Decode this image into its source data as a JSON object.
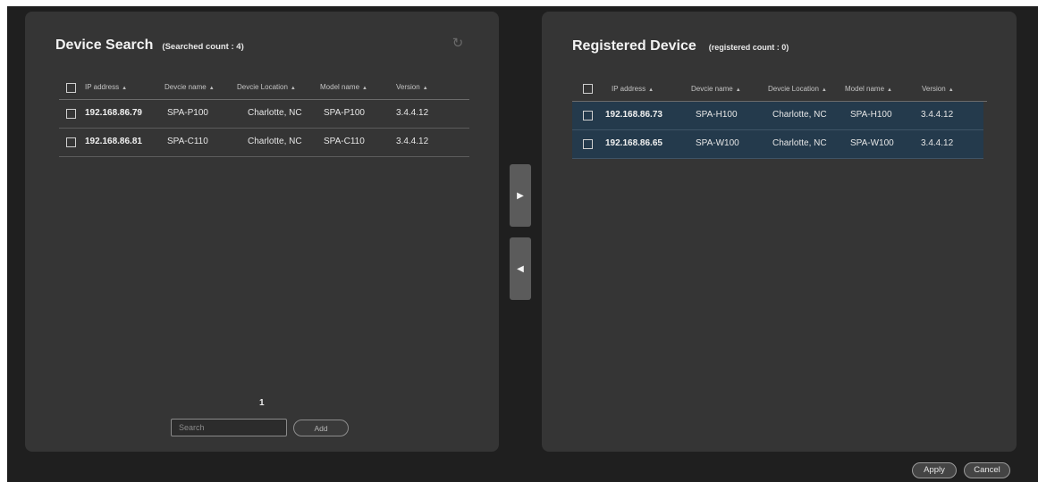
{
  "search_panel": {
    "title": "Device Search",
    "count_label": "(Searched count : 4)",
    "refresh_icon": "refresh-icon",
    "columns": [
      "IP address",
      "Devcie name",
      "Devcie Location",
      "Model name",
      "Version"
    ],
    "rows": [
      {
        "ip": "192.168.86.79",
        "device": "SPA-P100",
        "location": "Charlotte, NC",
        "model": "SPA-P100",
        "version": "3.4.4.12"
      },
      {
        "ip": "192.168.86.81",
        "device": "SPA-C110",
        "location": "Charlotte, NC",
        "model": "SPA-C110",
        "version": "3.4.4.12"
      }
    ],
    "page": "1",
    "search_placeholder": "Search",
    "search_value": "",
    "add_label": "Add"
  },
  "registered_panel": {
    "title": "Registered Device",
    "count_label": "(registered count : 0)",
    "columns": [
      "IP address",
      "Devcie name",
      "Devcie Location",
      "Model name",
      "Version"
    ],
    "rows": [
      {
        "ip": "192.168.86.73",
        "device": "SPA-H100",
        "location": "Charlotte, NC",
        "model": "SPA-H100",
        "version": "3.4.4.12"
      },
      {
        "ip": "192.168.86.65",
        "device": "SPA-W100",
        "location": "Charlotte, NC",
        "model": "SPA-W100",
        "version": "3.4.4.12"
      }
    ]
  },
  "transfer": {
    "right_icon": "play-right-icon",
    "left_icon": "play-left-icon"
  },
  "footer": {
    "apply_label": "Apply",
    "cancel_label": "Cancel"
  },
  "colors": {
    "background": "#1f1f1f",
    "panel": "#353535",
    "selected_row": "#243a4c"
  }
}
